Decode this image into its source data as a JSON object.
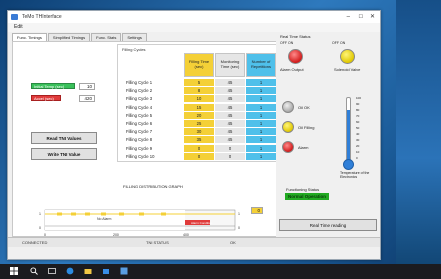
{
  "window": {
    "title": "TeMo THInterface"
  },
  "menu": {
    "edit": "Edit"
  },
  "tabs": [
    {
      "label": "Func. Timings"
    },
    {
      "label": "Simplified Timings"
    },
    {
      "label": "Func. Stats"
    },
    {
      "label": "Settings"
    }
  ],
  "left": {
    "initial_temp_label": "Initial Temp (sec)",
    "initial_temp_value": "10",
    "accel_label": "Accel (sec)",
    "accel_value": "420",
    "read_button": "Read TNI Values",
    "write_button": "Write TNI Value"
  },
  "grid": {
    "title": "Filling Cycles",
    "headers": [
      "Filling Time (sec)",
      "Monitoring Time (sec)",
      "Number of Repetitions"
    ],
    "rows": [
      {
        "label": "Filling Cycle 1",
        "filling": "5",
        "monitoring": "45",
        "reps": "1"
      },
      {
        "label": "Filling Cycle 2",
        "filling": "8",
        "monitoring": "45",
        "reps": "1"
      },
      {
        "label": "Filling Cycle 3",
        "filling": "10",
        "monitoring": "45",
        "reps": "1"
      },
      {
        "label": "Filling Cycle 4",
        "filling": "15",
        "monitoring": "45",
        "reps": "1"
      },
      {
        "label": "Filling Cycle 5",
        "filling": "20",
        "monitoring": "45",
        "reps": "1"
      },
      {
        "label": "Filling Cycle 6",
        "filling": "25",
        "monitoring": "45",
        "reps": "1"
      },
      {
        "label": "Filling Cycle 7",
        "filling": "30",
        "monitoring": "45",
        "reps": "1"
      },
      {
        "label": "Filling Cycle 8",
        "filling": "35",
        "monitoring": "45",
        "reps": "1"
      },
      {
        "label": "Filling Cycle 9",
        "filling": "0",
        "monitoring": "0",
        "reps": "1"
      },
      {
        "label": "Filling Cycle 10",
        "filling": "0",
        "monitoring": "0",
        "reps": "1"
      }
    ]
  },
  "chart": {
    "title": "FILLING DISTRIBUTION GRAPH",
    "xlabel": "Time (sec)",
    "xticks": [
      "0",
      "200",
      "400"
    ],
    "yticks_left": [
      "1",
      "0"
    ],
    "yticks_right": [
      "1",
      "0"
    ],
    "region_label": "No Alarm",
    "alarm_label": "Alarm Condition",
    "side_value": "0"
  },
  "right": {
    "title": "Real Time Status",
    "off_on_1": "OFF ON",
    "off_on_2": "OFF ON",
    "alarm_output": "Alarm Output",
    "solenoid": "Solenoid Valve",
    "oil_ok": "Oil OK",
    "oil_filling": "Oil Filling",
    "alarm": "Alarm",
    "therm_ticks": [
      "100",
      "90",
      "80",
      "70",
      "60",
      "50",
      "40",
      "30",
      "20",
      "10",
      "0"
    ],
    "therm_caption": "Temperature of the Electronics",
    "func_status_label": "Functioning Status",
    "func_status_value": "Normal Operation",
    "realtime_button": "Real Time reading"
  },
  "status": {
    "left": "CONNECTED",
    "mid": "TNI STATUS",
    "right": "OK"
  },
  "colors": {
    "yellow": "#f4d037",
    "blue": "#4fc0ea",
    "green": "#39c05a",
    "red": "#e03b3b",
    "status_green": "#22aa22"
  }
}
